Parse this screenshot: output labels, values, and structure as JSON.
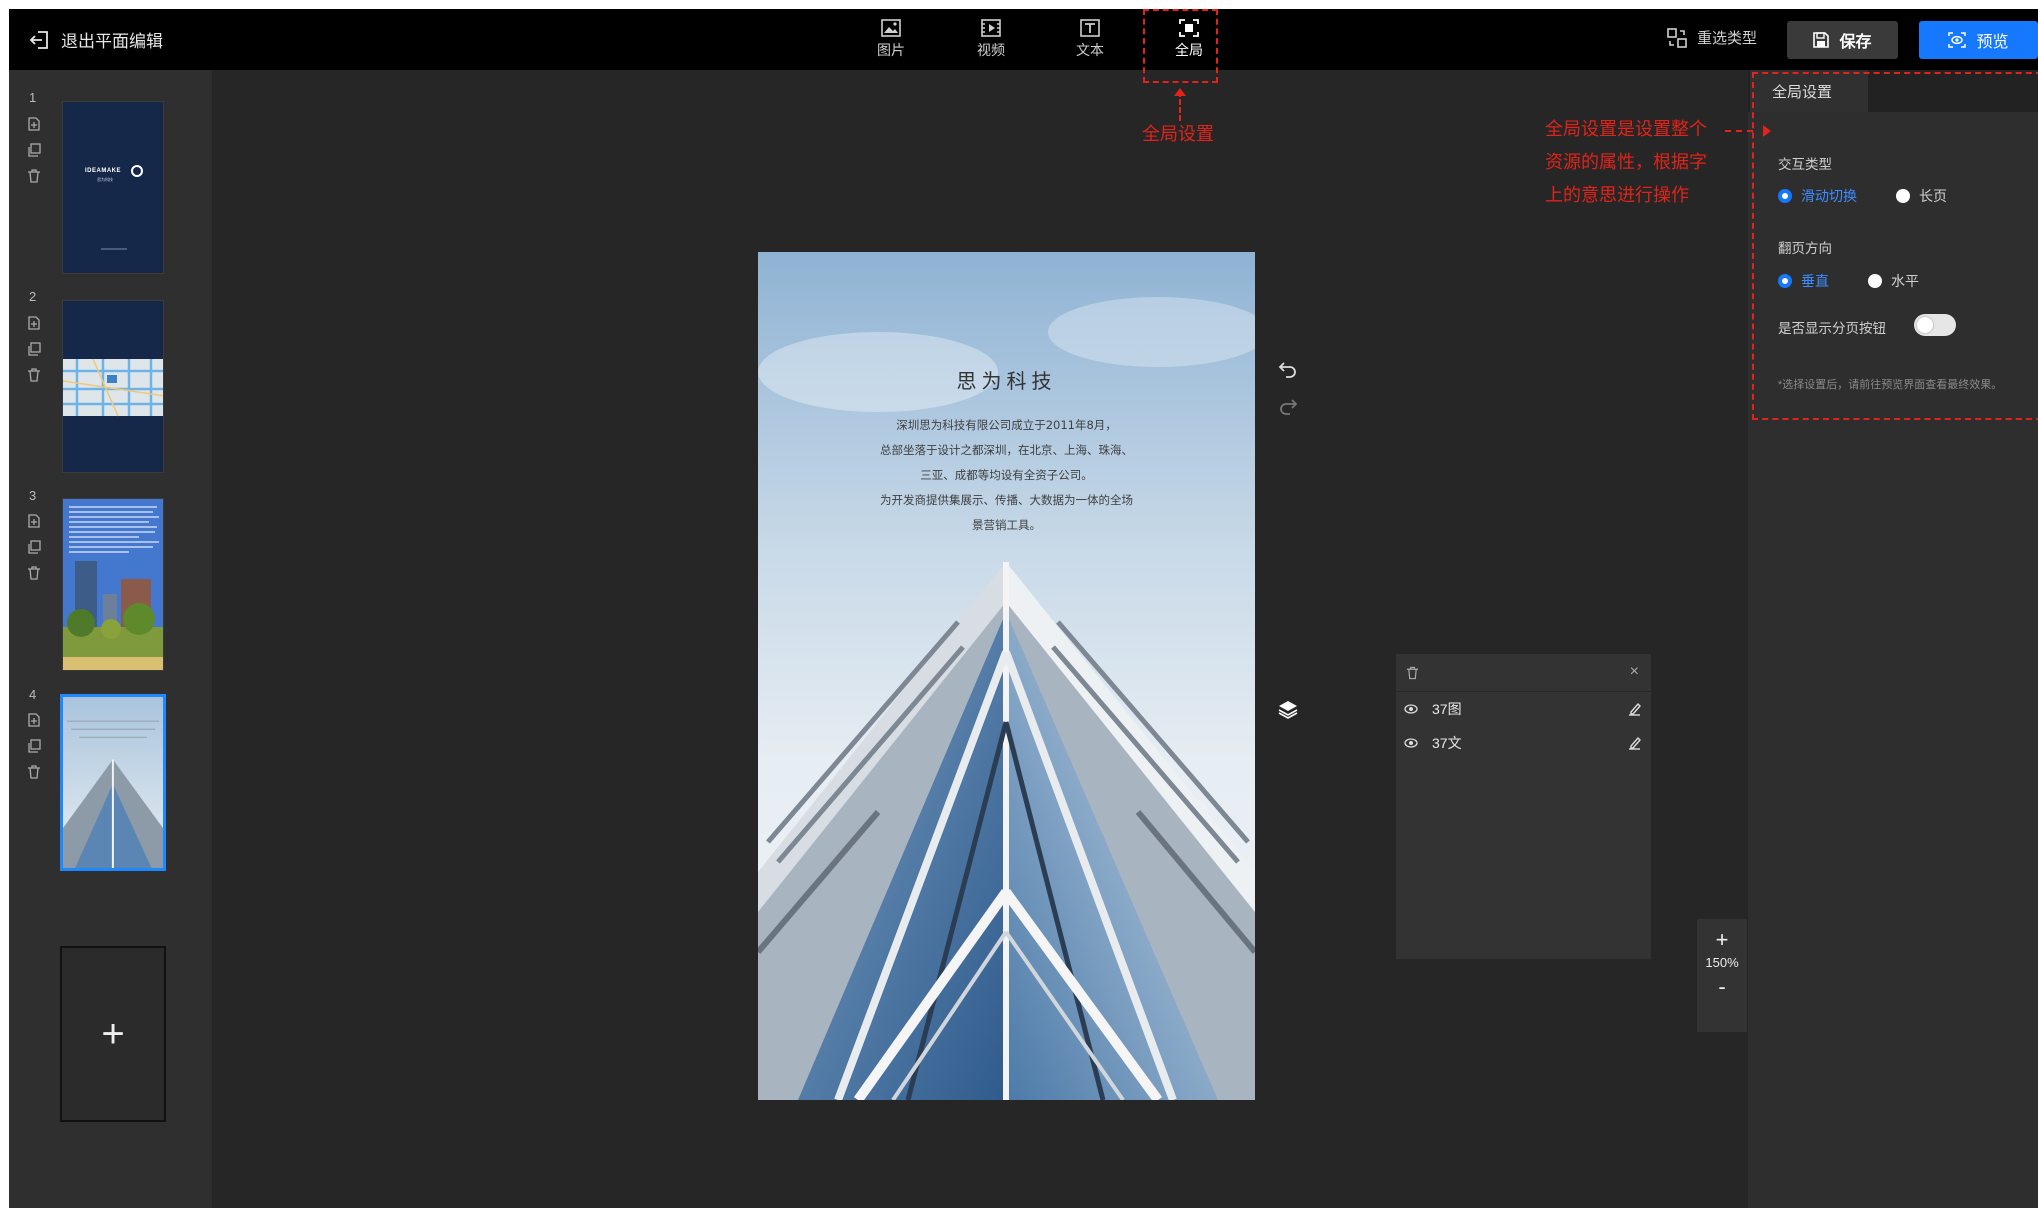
{
  "topbar": {
    "exit_label": "退出平面编辑",
    "tools": [
      {
        "label": "图片",
        "icon": "image-icon"
      },
      {
        "label": "视频",
        "icon": "video-icon"
      },
      {
        "label": "文本",
        "icon": "text-icon"
      },
      {
        "label": "全局",
        "icon": "global-icon",
        "active": true
      }
    ],
    "retype_label": "重选类型",
    "save_label": "保存",
    "preview_label": "预览"
  },
  "sidebar": {
    "pages": [
      {
        "number": "1",
        "thumb_text": "IDEAMAKE",
        "thumb_subtext": "思为科技"
      },
      {
        "number": "2"
      },
      {
        "number": "3"
      },
      {
        "number": "4",
        "active": true
      }
    ],
    "add_label": "+"
  },
  "canvas": {
    "title": "思为科技",
    "lines": [
      "深圳思为科技有限公司成立于2011年8月，",
      "总部坐落于设计之都深圳，在北京、上海、珠海、",
      "三亚、成都等均设有全资子公司。",
      "为开发商提供集展示、传播、大数据为一体的全场",
      "景营销工具。"
    ]
  },
  "layers": {
    "close_label": "×",
    "items": [
      {
        "name": "37图"
      },
      {
        "name": "37文"
      }
    ]
  },
  "zoom": {
    "plus": "+",
    "value": "150%",
    "minus": "-"
  },
  "right_panel": {
    "tab": "全局设置",
    "interaction_label": "交互类型",
    "interaction_options": [
      "滑动切换",
      "长页"
    ],
    "interaction_selected": "滑动切换",
    "direction_label": "翻页方向",
    "direction_options": [
      "垂直",
      "水平"
    ],
    "direction_selected": "垂直",
    "pager_label": "是否显示分页按钮",
    "pager_enabled": false,
    "hint": "*选择设置后，请前往预览界面查看最终效果。"
  },
  "annotations": {
    "global_caption": "全局设置",
    "panel_note_lines": [
      "全局设置是设置整个",
      "资源的属性，根据字",
      "上的意思进行操作"
    ],
    "color": "#e2231a"
  },
  "colors": {
    "accent": "#1677ff",
    "topbar": "#000000",
    "workspace": "#262626"
  }
}
